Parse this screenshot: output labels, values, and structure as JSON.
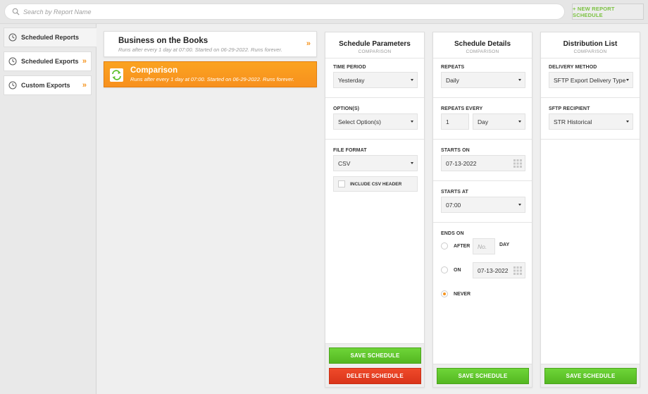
{
  "search": {
    "placeholder": "Search by Report Name"
  },
  "toolbar": {
    "new_schedule_label": "+ NEW REPORT SCHEDULE"
  },
  "sidebar": {
    "items": [
      {
        "label": "Scheduled Reports",
        "icon": "clock-icon",
        "active": true
      },
      {
        "label": "Scheduled Exports",
        "icon": "clock-icon",
        "chevron": "»"
      },
      {
        "label": "Custom Exports",
        "icon": "clock-icon",
        "chevron": "»"
      }
    ]
  },
  "reports": [
    {
      "title": "Business on the Books",
      "subtitle": "Runs after every 1 day at 07:00. Started on 06-29-2022. Runs forever.",
      "chevron": "»"
    },
    {
      "title": "Comparison",
      "subtitle": "Runs after every 1 day at 07:00. Started on 06-29-2022. Runs forever.",
      "active": true
    }
  ],
  "schedule_parameters": {
    "title": "Schedule Parameters",
    "subtitle": "COMPARISON",
    "time_period_label": "TIME PERIOD",
    "time_period_value": "Yesterday",
    "options_label": "OPTION(S)",
    "options_value": "Select Option(s)",
    "file_format_label": "FILE FORMAT",
    "file_format_value": "CSV",
    "csv_header_label": "INCLUDE CSV HEADER",
    "save_label": "SAVE SCHEDULE",
    "delete_label": "DELETE SCHEDULE"
  },
  "schedule_details": {
    "title": "Schedule Details",
    "subtitle": "COMPARISON",
    "repeats_label": "REPEATS",
    "repeats_value": "Daily",
    "repeats_every_label": "REPEATS EVERY",
    "repeats_every_number": "1",
    "repeats_every_unit": "Day",
    "starts_on_label": "STARTS ON",
    "starts_on_value": "07-13-2022",
    "starts_at_label": "STARTS AT",
    "starts_at_value": "07:00",
    "ends_on_label": "ENDS ON",
    "after_label": "AFTER",
    "after_placeholder": "No.",
    "day_label": "DAY",
    "on_label": "ON",
    "on_value": "07-13-2022",
    "never_label": "NEVER",
    "selected_end": "never",
    "save_label": "SAVE SCHEDULE"
  },
  "distribution_list": {
    "title": "Distribution List",
    "subtitle": "COMPARISON",
    "delivery_method_label": "DELIVERY METHOD",
    "delivery_method_value": "SFTP Export Delivery Type",
    "sftp_recipient_label": "SFTP RECIPIENT",
    "sftp_recipient_value": "STR Historical",
    "save_label": "SAVE SCHEDULE"
  },
  "colors": {
    "accent_orange": "#f7941e",
    "save_green": "#5cc02a",
    "delete_red": "#e03d20",
    "new_schedule_green": "#7cc242"
  }
}
